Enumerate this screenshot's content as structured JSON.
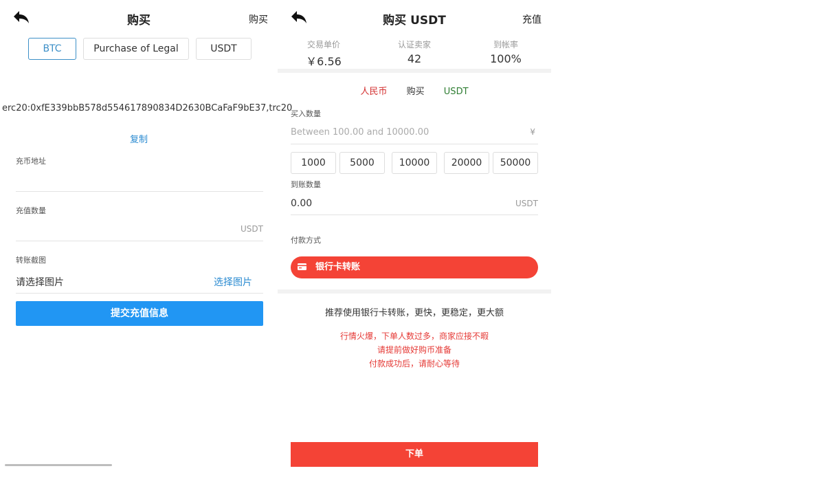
{
  "left": {
    "title": "购买",
    "top_right": "购买",
    "tabs": [
      "BTC",
      "Purchase of Legal",
      "USDT"
    ],
    "address": "erc20:0xfE339bbB578d554617890834D2630BCaFaF9bE37,trc20",
    "copy": "复制",
    "coin_address_label": "充币地址",
    "amount_label": "充值数量",
    "amount_unit": "USDT",
    "screenshot_label": "转账截图",
    "screenshot_placeholder": "请选择图片",
    "screenshot_pick": "选择图片",
    "submit": "提交充值信息"
  },
  "right": {
    "title": "购买 USDT",
    "top_right": "充值",
    "stats": [
      {
        "label": "交易单价",
        "value": "￥6.56"
      },
      {
        "label": "认证卖家",
        "value": "42"
      },
      {
        "label": "到帐率",
        "value": "100%"
      }
    ],
    "tabs": [
      {
        "label": "人民币",
        "color": "#d32f2f"
      },
      {
        "label": "购买",
        "color": "#333333"
      },
      {
        "label": "USDT",
        "color": "#2e7d32"
      }
    ],
    "buy_amount_label": "买入数量",
    "buy_amount_placeholder": "Between 100.00 and 10000.00",
    "buy_amount_unit": "¥",
    "presets": [
      "1000",
      "5000",
      "10000",
      "20000",
      "50000"
    ],
    "receive_label": "到账数量",
    "receive_value": "0.00",
    "receive_unit": "USDT",
    "payment_label": "付款方式",
    "payment_method": "银行卡转账",
    "recommend": "推荐使用银行卡转账，更快，更稳定，更大额",
    "warnings": [
      "行情火爆，下单人数过多，商家应接不暇",
      "请提前做好购币准备",
      "付款成功后，请耐心等待"
    ],
    "order": "下单"
  },
  "colors": {
    "accent_blue": "#2196f3",
    "accent_red": "#f44336",
    "link_blue": "#2b8bd1"
  }
}
